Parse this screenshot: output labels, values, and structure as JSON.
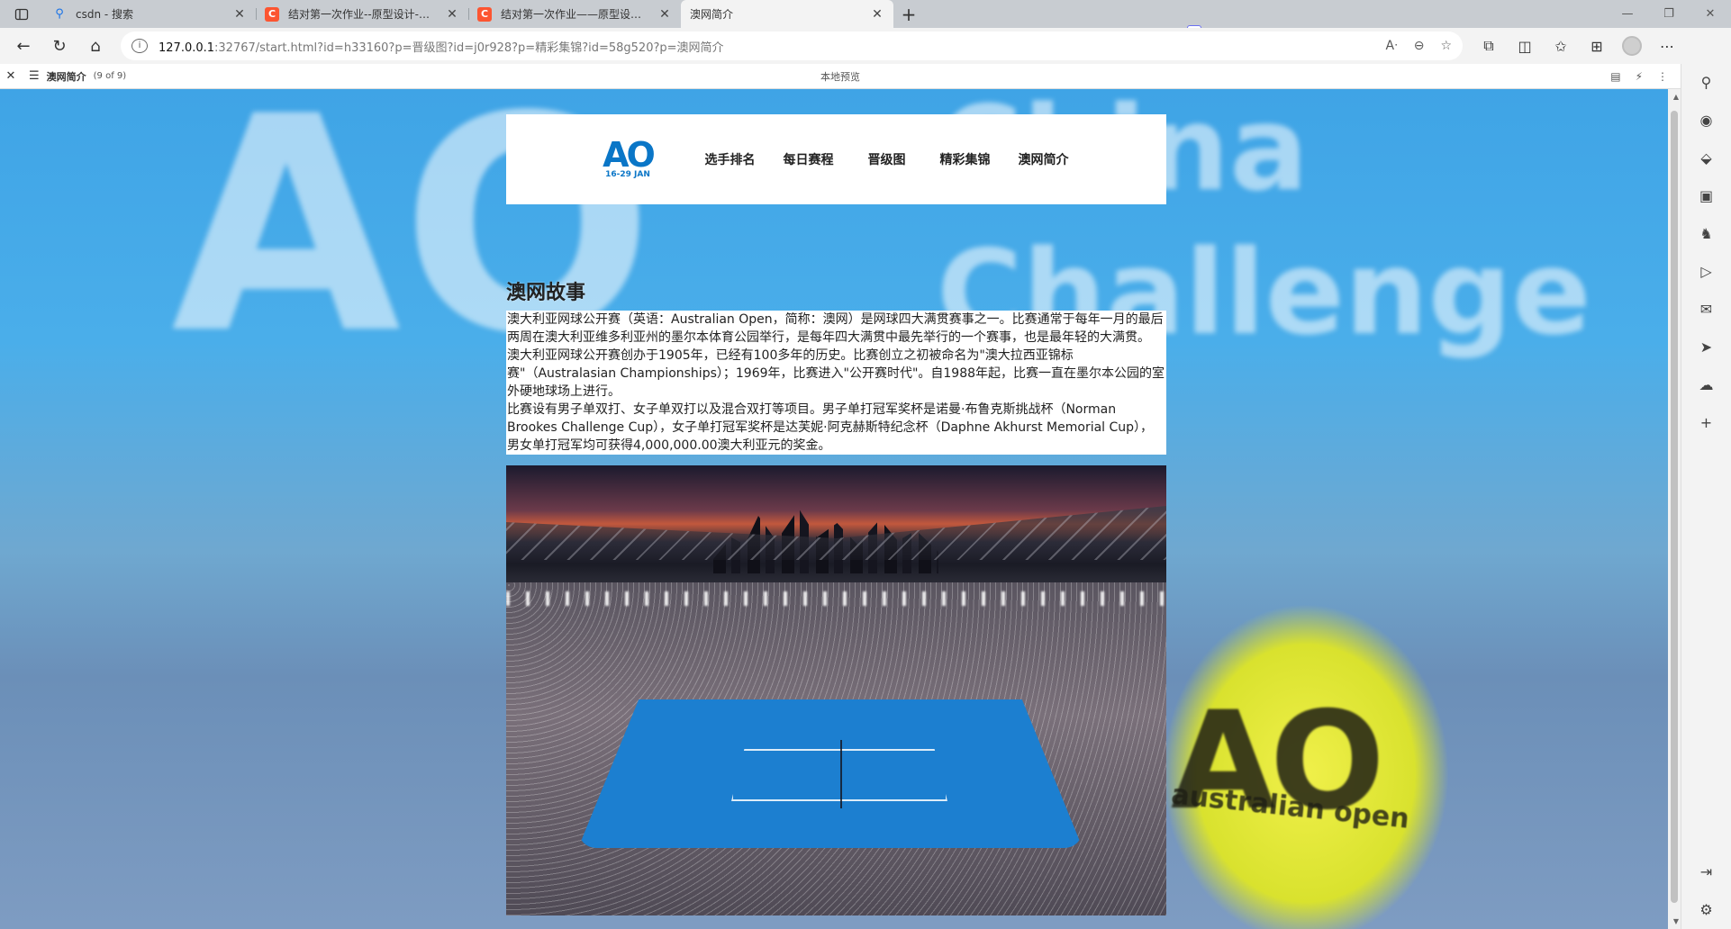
{
  "browser": {
    "tabs": [
      {
        "title": "csdn - 搜索",
        "icon": "search-icon"
      },
      {
        "title": "结对第一次作业--原型设计-CSDN",
        "icon": "csdn-icon"
      },
      {
        "title": "结对第一次作业——原型设计-CS",
        "icon": "csdn-icon"
      },
      {
        "title": "澳网简介",
        "icon": "page-icon",
        "active": true
      }
    ],
    "address": {
      "host": "127.0.0.1",
      "rest": ":32767/start.html?id=h33160?p=晋级图?id=j0r928?p=精彩集锦?id=58g520?p=澳网简介"
    }
  },
  "preview": {
    "page_name": "澳网简介",
    "page_count": "(9 of 9)",
    "mode_label": "本地预览"
  },
  "site": {
    "logo_text": "AO",
    "logo_date": "16-29 JAN",
    "nav": [
      "选手排名",
      "每日赛程",
      "晋级图",
      "精彩集锦",
      "澳网简介"
    ]
  },
  "article": {
    "title": "澳网故事",
    "paragraphs": [
      "澳大利亚网球公开赛（英语：Australian Open，简称：澳网）是网球四大满贯赛事之一。比赛通常于每年一月的最后两周在澳大利亚维多利亚州的墨尔本体育公园举行，是每年四大满贯中最先举行的一个赛事，也是最年轻的大满贯。",
      "澳大利亚网球公开赛创办于1905年，已经有100多年的历史。比赛创立之初被命名为\"澳大拉西亚锦标赛\"（Australasian Championships）；1969年，比赛进入\"公开赛时代\"。自1988年起，比赛一直在墨尔本公园的室外硬地球场上进行。",
      "比赛设有男子单双打、女子单双打以及混合双打等项目。男子单打冠军奖杯是诺曼·布鲁克斯挑战杯（Norman Brookes Challenge Cup），女子单打冠军奖杯是达芙妮·阿克赫斯特纪念杯（Daphne Akhurst Memorial Cup），男女单打冠军均可获得4,000,000.00澳大利亚元的奖金。"
    ]
  },
  "background": {
    "big_text": "AO",
    "text_line1": "China",
    "text_line2": "Challenge",
    "ball_logo": "AO",
    "ball_sub": "australian open"
  },
  "colors": {
    "brand_blue": "#0a76c7",
    "sky_blue": "#3fa4e6",
    "csdn_red": "#fc5531"
  }
}
